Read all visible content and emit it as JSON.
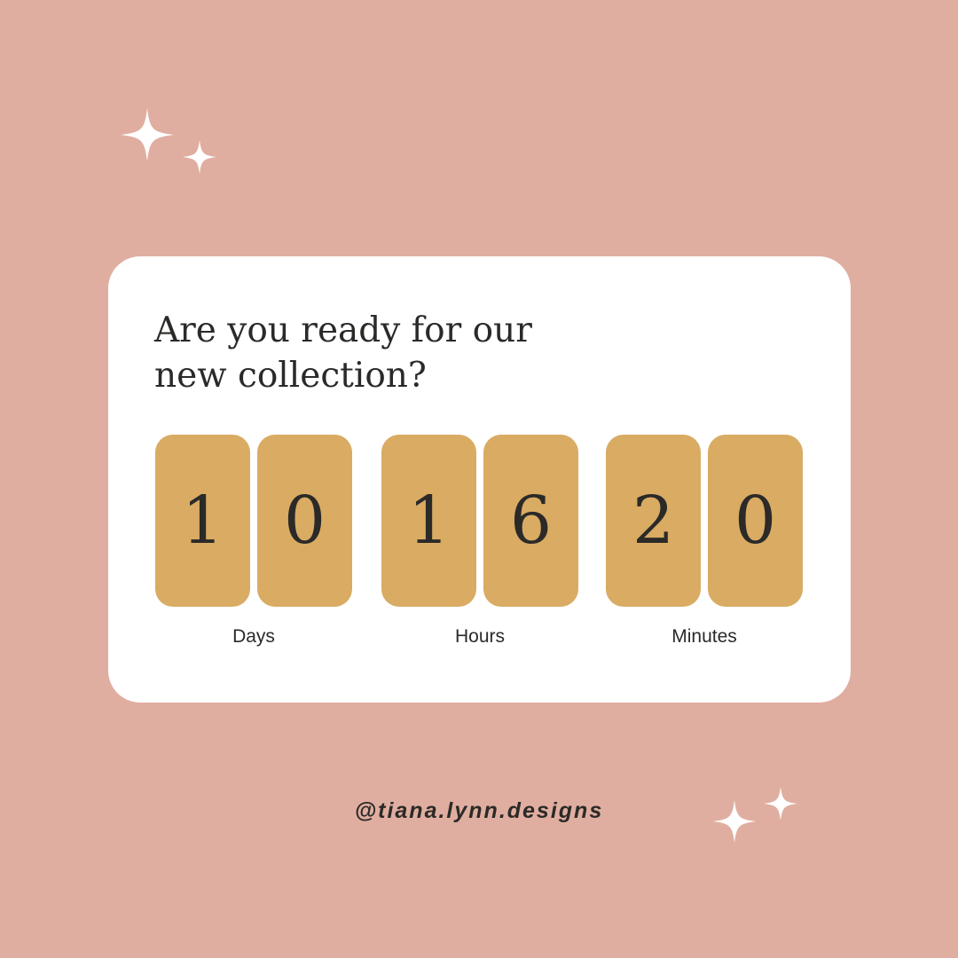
{
  "colors": {
    "background": "#e0aea0",
    "card": "#ffffff",
    "tile": "#d9ab63",
    "text": "#2b2a28",
    "sparkle": "#ffffff"
  },
  "headline": {
    "line1": "Are you ready for our",
    "line2": "new collection?"
  },
  "countdown": {
    "days": {
      "digits": [
        "1",
        "0"
      ],
      "label": "Days"
    },
    "hours": {
      "digits": [
        "1",
        "6"
      ],
      "label": "Hours"
    },
    "minutes": {
      "digits": [
        "2",
        "0"
      ],
      "label": "Minutes"
    }
  },
  "handle": "@tiana.lynn.designs",
  "icons": [
    "sparkle-icon"
  ]
}
